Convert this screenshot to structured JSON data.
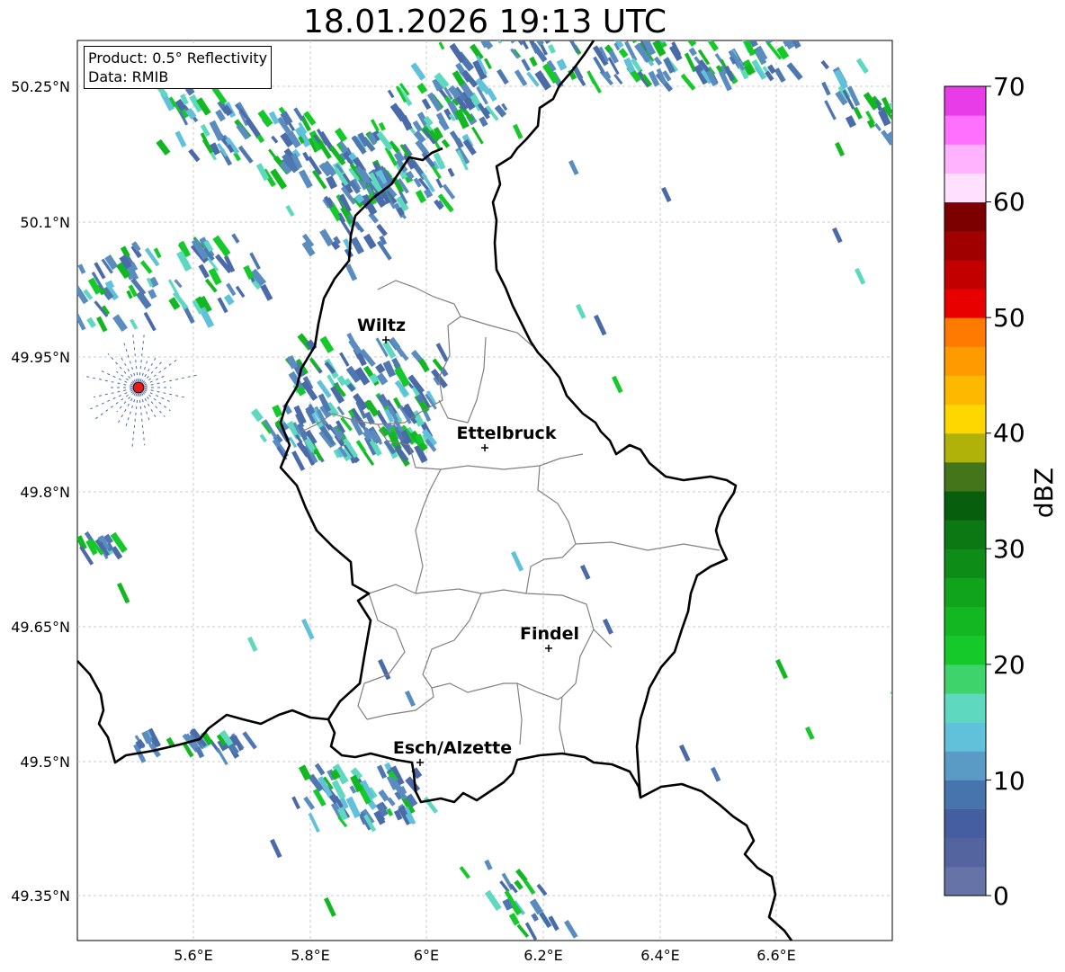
{
  "title": "18.01.2026 19:13 UTC",
  "info": {
    "product_line": "Product: 0.5° Reflectivity",
    "source_line": "Data: RMIB"
  },
  "lon_ticks": [
    "5.6°E",
    "5.8°E",
    "6°E",
    "6.2°E",
    "6.4°E",
    "6.6°E"
  ],
  "lat_ticks": [
    "50.25°N",
    "50.1°N",
    "49.95°N",
    "49.8°N",
    "49.65°N",
    "49.5°N",
    "49.35°N"
  ],
  "cities": [
    {
      "name": "Wiltz",
      "icon": "cross-marker-icon"
    },
    {
      "name": "Ettelbruck",
      "icon": "cross-marker-icon"
    },
    {
      "name": "Findel",
      "icon": "cross-marker-icon"
    },
    {
      "name": "Esch/Alzette",
      "icon": "cross-marker-icon"
    }
  ],
  "radar_site_icon": "red-dot-icon",
  "colorbar": {
    "label": "dBZ",
    "ticks": [
      "0",
      "10",
      "20",
      "30",
      "40",
      "50",
      "60",
      "70"
    ],
    "colors": [
      "#6573a6",
      "#53649e",
      "#455ea0",
      "#4774ad",
      "#5a9bc6",
      "#62c1da",
      "#5fd8c0",
      "#3fd36b",
      "#15c92a",
      "#12b722",
      "#10a31c",
      "#0d8d17",
      "#0b7813",
      "#075f0e",
      "#44751a",
      "#b0b20a",
      "#ffd700",
      "#ffb800",
      "#ff9a00",
      "#ff7a00",
      "#e80000",
      "#c20000",
      "#a10000",
      "#7d0000",
      "#ffe0ff",
      "#ffb3ff",
      "#ff70ff",
      "#e83ce8"
    ]
  }
}
